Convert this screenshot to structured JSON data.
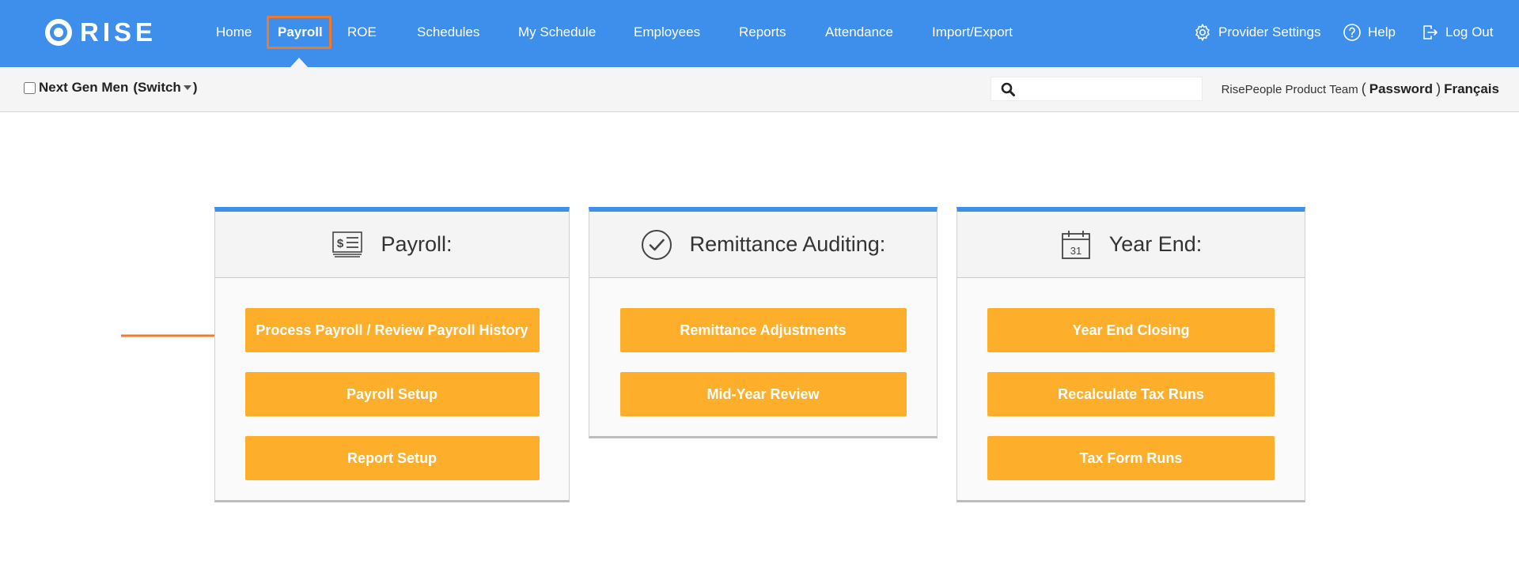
{
  "app": {
    "logo_text": "RISE"
  },
  "nav": {
    "items": [
      {
        "label": "Home"
      },
      {
        "label": "Payroll"
      },
      {
        "label": "ROE"
      },
      {
        "label": "Schedules"
      },
      {
        "label": "My Schedule"
      },
      {
        "label": "Employees"
      },
      {
        "label": "Reports"
      },
      {
        "label": "Attendance"
      },
      {
        "label": "Import/Export"
      }
    ],
    "active": "Payroll",
    "highlight_color": "#f0792a"
  },
  "utilities": {
    "provider_settings": "Provider Settings",
    "help": "Help",
    "logout": "Log Out"
  },
  "subbar": {
    "company_name": "Next Gen Men",
    "open_paren": "(",
    "switch_label": "Switch",
    "close_paren": ")",
    "search_placeholder": "",
    "user_name": "RisePeople Product Team",
    "user_open": "(",
    "password_label": "Password",
    "user_close": ")",
    "language_label": "Français"
  },
  "cards": [
    {
      "title": "Payroll:",
      "icon": "receipt-icon",
      "buttons": [
        "Process Payroll / Review Payroll History",
        "Payroll Setup",
        "Report Setup"
      ]
    },
    {
      "title": "Remittance Auditing:",
      "icon": "checkmark-circle-icon",
      "buttons": [
        "Remittance Adjustments",
        "Mid-Year Review"
      ]
    },
    {
      "title": "Year End:",
      "icon": "calendar-icon",
      "calendar_day": "31",
      "buttons": [
        "Year End Closing",
        "Recalculate Tax Runs",
        "Tax Form Runs"
      ]
    }
  ],
  "colors": {
    "header_blue": "#3e8eeb",
    "button_orange": "#fdae2b",
    "annotation_orange": "#f0792a"
  }
}
